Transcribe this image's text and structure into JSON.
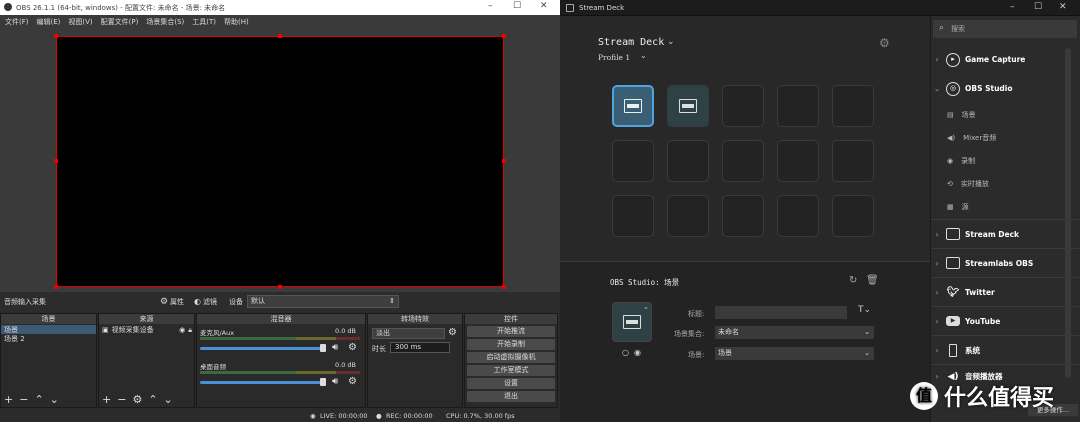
{
  "obs": {
    "title": "OBS 26.1.1 (64-bit, windows) - 配置文件: 未命名 - 场景: 未命名",
    "menu": [
      "文件(F)",
      "编辑(E)",
      "视图(V)",
      "配置文件(P)",
      "场景集合(S)",
      "工具(T)",
      "帮助(H)"
    ],
    "source_bar": {
      "name": "音频输入采集",
      "props": "属性",
      "filters": "滤镜",
      "device_label": "设备",
      "device_value": "默认"
    },
    "scenes": {
      "header": "场景",
      "items": [
        "场景",
        "场景 2"
      ]
    },
    "sources": {
      "header": "来源",
      "items": [
        "视频采集设备"
      ]
    },
    "mixer": {
      "header": "混音器",
      "channels": [
        {
          "name": "麦克风/Aux",
          "db": "0.0 dB"
        },
        {
          "name": "桌面音频",
          "db": "0.0 dB"
        }
      ]
    },
    "transitions": {
      "header": "转场特效",
      "type": "淡出",
      "duration_label": "时长",
      "duration": "300 ms"
    },
    "controls": {
      "header": "控件",
      "buttons": [
        "开始推流",
        "开始录制",
        "启动虚拟摄像机",
        "工作室模式",
        "设置",
        "退出"
      ]
    },
    "status": {
      "live": "LIVE: 00:00:00",
      "rec": "REC: 00:00:00",
      "cpu": "CPU: 0.7%, 30.00 fps"
    }
  },
  "streamdeck": {
    "title": "Stream Deck",
    "device": "Stream Deck",
    "profile": "Profile 1",
    "action_title": "OBS Studio: 场景",
    "fields": {
      "title_label": "标题:",
      "scene_collection_label": "场景集合:",
      "scene_collection_value": "未命名",
      "scene_label": "场景:",
      "scene_value": "场景"
    },
    "search_placeholder": "搜索",
    "sidebar": [
      {
        "label": "Game Capture",
        "icon": "game-capture-icon"
      },
      {
        "label": "OBS Studio",
        "icon": "obs-icon"
      },
      {
        "label": "Stream Deck",
        "icon": "streamdeck-icon"
      },
      {
        "label": "Streamlabs OBS",
        "icon": "streamlabs-icon"
      },
      {
        "label": "Twitter",
        "icon": "twitter-icon"
      },
      {
        "label": "YouTube",
        "icon": "youtube-icon"
      },
      {
        "label": "系统",
        "icon": "system-icon"
      },
      {
        "label": "音频播放器",
        "icon": "audio-player-icon"
      }
    ],
    "obs_sub": [
      "场景",
      "Mixer音频",
      "录制",
      "实时播放",
      "源"
    ],
    "more": "更多操作..."
  },
  "watermark": "值 什么值得买",
  "colors": {
    "obs_border": "#e00000",
    "sd_accent": "#4ea3e0",
    "sd_key_active": "#3a5f74"
  }
}
